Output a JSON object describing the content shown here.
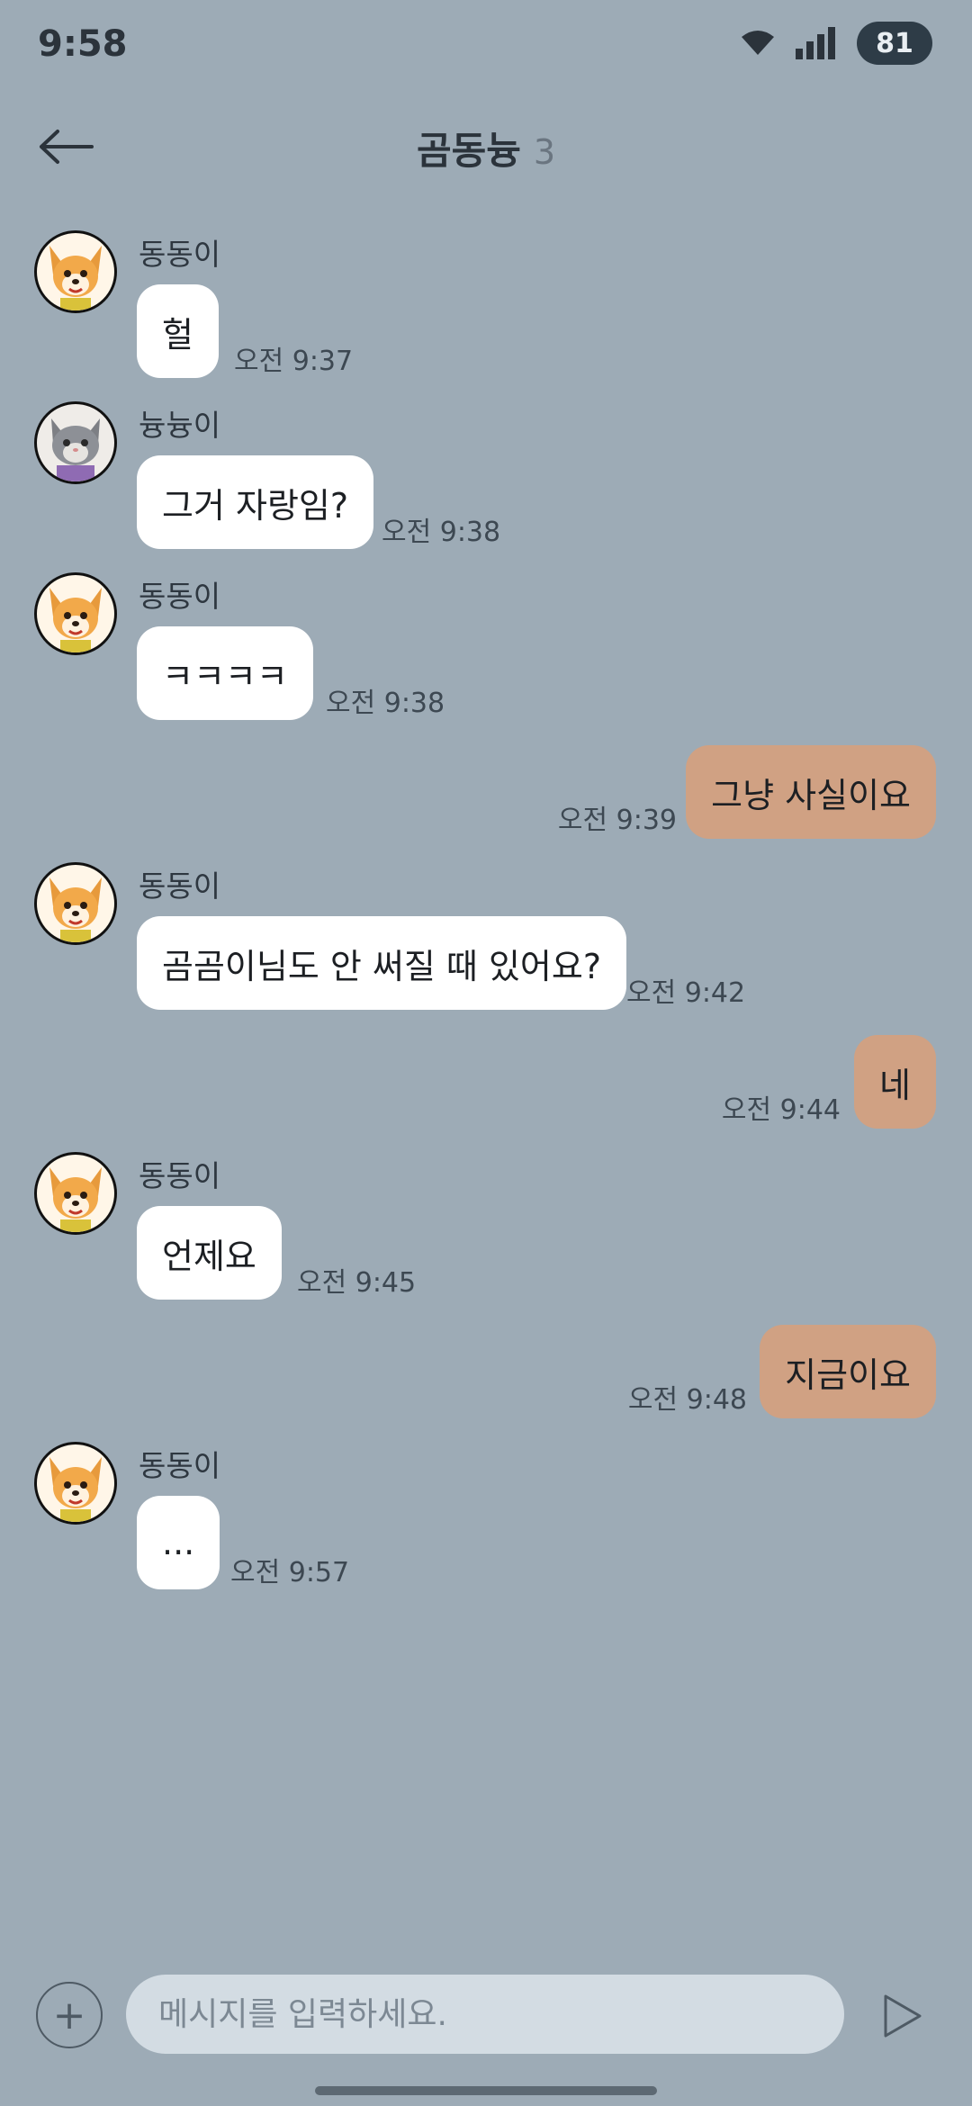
{
  "status": {
    "time": "9:58",
    "battery": "81"
  },
  "header": {
    "title": "곰동늉",
    "member_count": "3"
  },
  "messages": [
    {
      "sender": "동동이",
      "text": "헐",
      "time": "오전 9:37",
      "avatar": "dog-avatar"
    },
    {
      "sender": "늉늉이",
      "text": "그거 자랑임?",
      "time": "오전 9:38",
      "avatar": "cat-avatar"
    },
    {
      "sender": "동동이",
      "text": "ㅋㅋㅋㅋ",
      "time": "오전 9:38",
      "avatar": "dog-avatar"
    },
    {
      "mine": true,
      "text": "그냥 사실이요",
      "time": "오전 9:39"
    },
    {
      "sender": "동동이",
      "text": "곰곰이님도 안 써질 때 있어요?",
      "time": "오전 9:42",
      "avatar": "dog-avatar"
    },
    {
      "mine": true,
      "text": "네",
      "time": "오전 9:44"
    },
    {
      "sender": "동동이",
      "text": "언제요",
      "time": "오전 9:45",
      "avatar": "dog-avatar"
    },
    {
      "mine": true,
      "text": "지금이요",
      "time": "오전 9:48"
    },
    {
      "sender": "동동이",
      "text": "...",
      "time": "오전 9:57",
      "avatar": "dog-avatar"
    }
  ],
  "composer": {
    "placeholder": "메시지를 입력하세요.",
    "add_icon": "plus-icon",
    "send_icon": "send-icon"
  },
  "colors": {
    "background": "#9dabb6",
    "incoming_bubble": "#ffffff",
    "outgoing_bubble": "#d0a183"
  }
}
